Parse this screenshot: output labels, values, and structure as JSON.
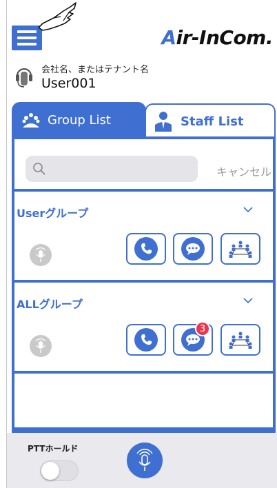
{
  "header": {
    "brand_a": "A",
    "brand_rest": "ir-InCom."
  },
  "tenant": {
    "label": "会社名、またはテナント名",
    "user": "User001"
  },
  "tabs": [
    {
      "label": "Group List",
      "active": true
    },
    {
      "label": "Staff List",
      "active": false
    }
  ],
  "search": {
    "placeholder": "",
    "cancel_label": "キャンセル"
  },
  "groups": [
    {
      "name": "Userグループ",
      "chat_badge": null
    },
    {
      "name": "ALLグループ",
      "chat_badge": "3"
    }
  ],
  "footer": {
    "ptt_label": "PTTホールド",
    "ptt_hold_on": false
  },
  "colors": {
    "accent": "#3f6fd1",
    "badge": "#e8364f",
    "disabled_mic": "#c9c9c9"
  },
  "icons": {
    "menu": "hamburger-icon",
    "cursor": "pointing-hand-icon",
    "tenant": "headset-icon",
    "group_tab": "group-people-icon",
    "staff_tab": "person-icon",
    "search": "magnifier-icon",
    "expand": "chevron-down-icon",
    "call": "phone-icon",
    "chat": "chat-bubble-icon",
    "meeting": "meeting-table-icon",
    "mic": "microphone-icon"
  }
}
